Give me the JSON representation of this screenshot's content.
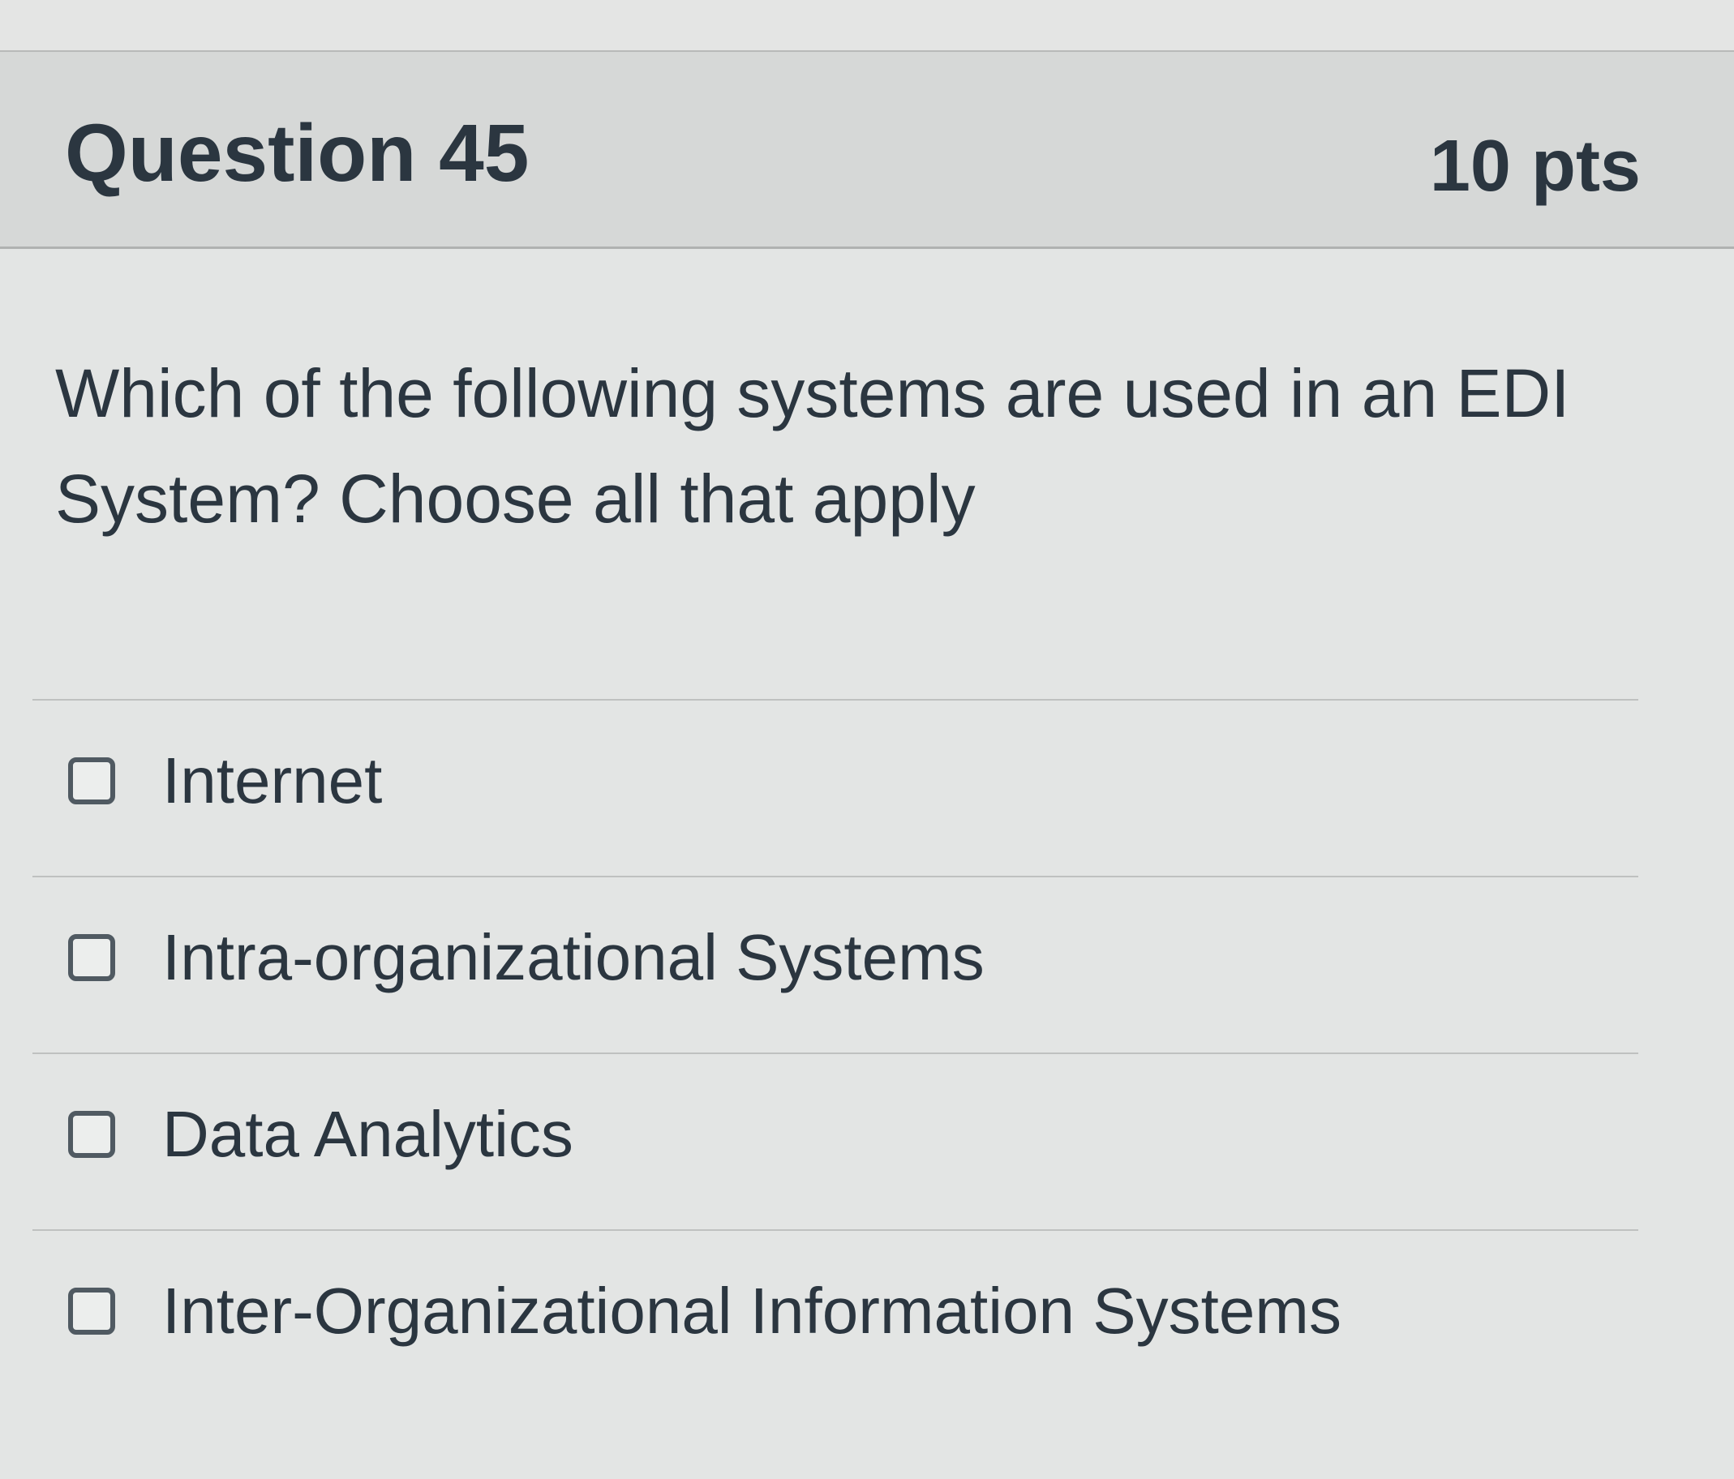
{
  "question": {
    "title": "Question 45",
    "points": "10 pts",
    "text": "Which of the following systems are used in an EDI System? Choose all that apply"
  },
  "answers": [
    {
      "label": "Internet",
      "checked": false
    },
    {
      "label": "Intra-organizational Systems",
      "checked": false
    },
    {
      "label": "Data Analytics",
      "checked": false
    },
    {
      "label": "Inter-Organizational Information Systems",
      "checked": false
    }
  ],
  "colors": {
    "background": "#e4e5e4",
    "header": "#d6d8d7",
    "text": "#2b3640"
  }
}
